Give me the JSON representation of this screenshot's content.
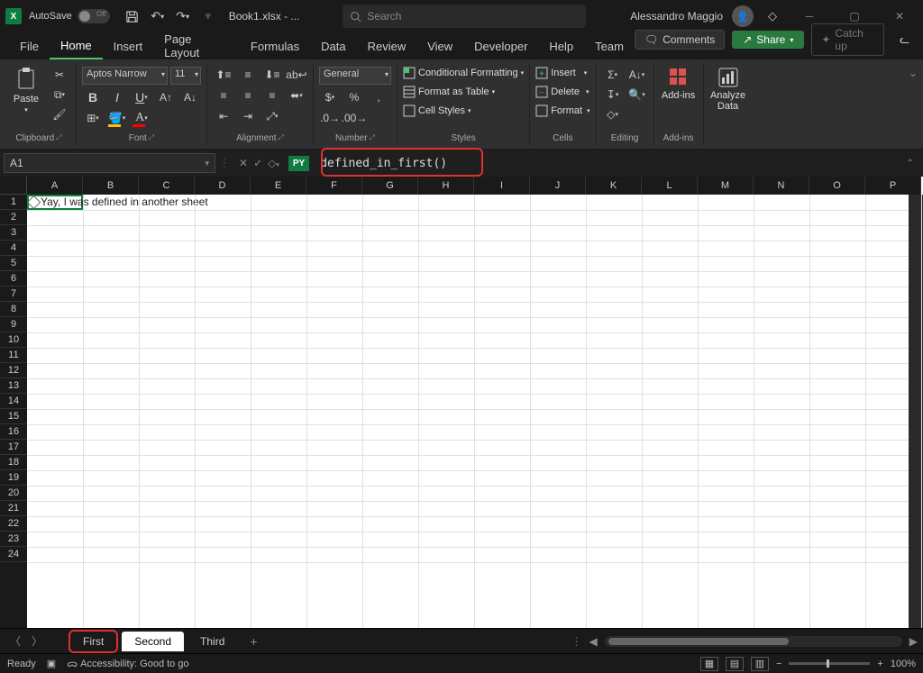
{
  "titlebar": {
    "autosave_label": "AutoSave",
    "autosave_state": "Off",
    "book_name": "Book1.xlsx - ...",
    "search_placeholder": "Search",
    "user_name": "Alessandro Maggio"
  },
  "tabs": {
    "items": [
      "File",
      "Home",
      "Insert",
      "Page Layout",
      "Formulas",
      "Data",
      "Review",
      "View",
      "Developer",
      "Help",
      "Team"
    ],
    "active": "Home",
    "comments": "Comments",
    "share": "Share",
    "catchup": "Catch up"
  },
  "ribbon": {
    "clipboard": {
      "paste": "Paste",
      "label": "Clipboard"
    },
    "font": {
      "name": "Aptos Narrow",
      "size": "11",
      "label": "Font"
    },
    "alignment": {
      "label": "Alignment"
    },
    "number": {
      "format": "General",
      "label": "Number"
    },
    "styles": {
      "cf": "Conditional Formatting",
      "fat": "Format as Table",
      "cs": "Cell Styles",
      "label": "Styles"
    },
    "cells": {
      "insert": "Insert",
      "delete": "Delete",
      "format": "Format",
      "label": "Cells"
    },
    "editing": {
      "label": "Editing"
    },
    "addins": {
      "label": "Add-ins",
      "btn": "Add-ins"
    },
    "analyze": {
      "label": "Analyze Data",
      "btn": "Analyze\nData"
    }
  },
  "formula": {
    "cellref": "A1",
    "py_badge": "PY",
    "text": "defined_in_first()"
  },
  "grid": {
    "cols": [
      "A",
      "B",
      "C",
      "D",
      "E",
      "F",
      "G",
      "H",
      "I",
      "J",
      "K",
      "L",
      "M",
      "N",
      "O",
      "P"
    ],
    "rows": 24,
    "a1_value": "Yay, I was defined in another sheet"
  },
  "sheets": {
    "tabs": [
      "First",
      "Second",
      "Third"
    ],
    "active_index": 1
  },
  "status": {
    "ready": "Ready",
    "accessibility": "Accessibility: Good to go",
    "zoom": "100%"
  }
}
